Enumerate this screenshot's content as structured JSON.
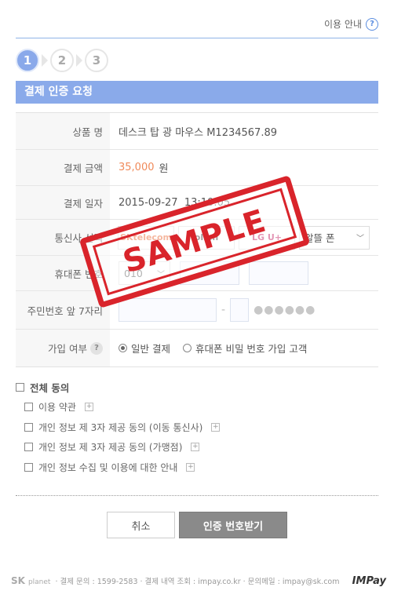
{
  "help": {
    "label": "이용 안내",
    "icon": "?"
  },
  "steps": [
    "1",
    "2",
    "3"
  ],
  "section_title": "결제 인증 요청",
  "product": {
    "label": "상품 명",
    "value": "데스크 탑 광 마우스 M1234567.89"
  },
  "amount": {
    "label": "결제 금액",
    "value": "35,000",
    "unit": "원"
  },
  "date": {
    "label": "결제 일자",
    "value": "2015-09-27  13:10:05"
  },
  "carrier": {
    "label": "통신사 선택",
    "options": [
      "SKtelecom",
      "olleh",
      "LG U+"
    ],
    "mvno": "알뜰 폰"
  },
  "phone": {
    "label": "휴대폰 번호",
    "prefix": "010"
  },
  "resident": {
    "label": "주민번호 앞 7자리",
    "dash": "-",
    "mask": "●●●●●●"
  },
  "join": {
    "label": "가입 여부",
    "help": "?",
    "options": [
      "일반 결제",
      "휴대폰 비밀 번호 가입 고객"
    ],
    "selected": 0
  },
  "agreements": {
    "all": "전체 동의",
    "items": [
      "이용 약관",
      "개인 정보 제 3자 제공 동의 (이동 통신사)",
      "개인 정보 제 3자 제공 동의 (가맹점)",
      "개인 정보 수집 및 이용에 대한 안내"
    ],
    "expand": "+"
  },
  "buttons": {
    "cancel": "취소",
    "request": "인증 번호받기"
  },
  "footer": {
    "logo": "SK",
    "logo_sub": "planet",
    "info": "· 결제 문의 : 1599-2583  · 결제 내역 조회 : impay.co.kr  · 문의메일 : impay@sk.com",
    "brand": "IMPay"
  },
  "stamp": "SAMPLE",
  "colors": {
    "accent": "#8aaaea",
    "price": "#f08a5a",
    "stamp": "#d9242b"
  }
}
